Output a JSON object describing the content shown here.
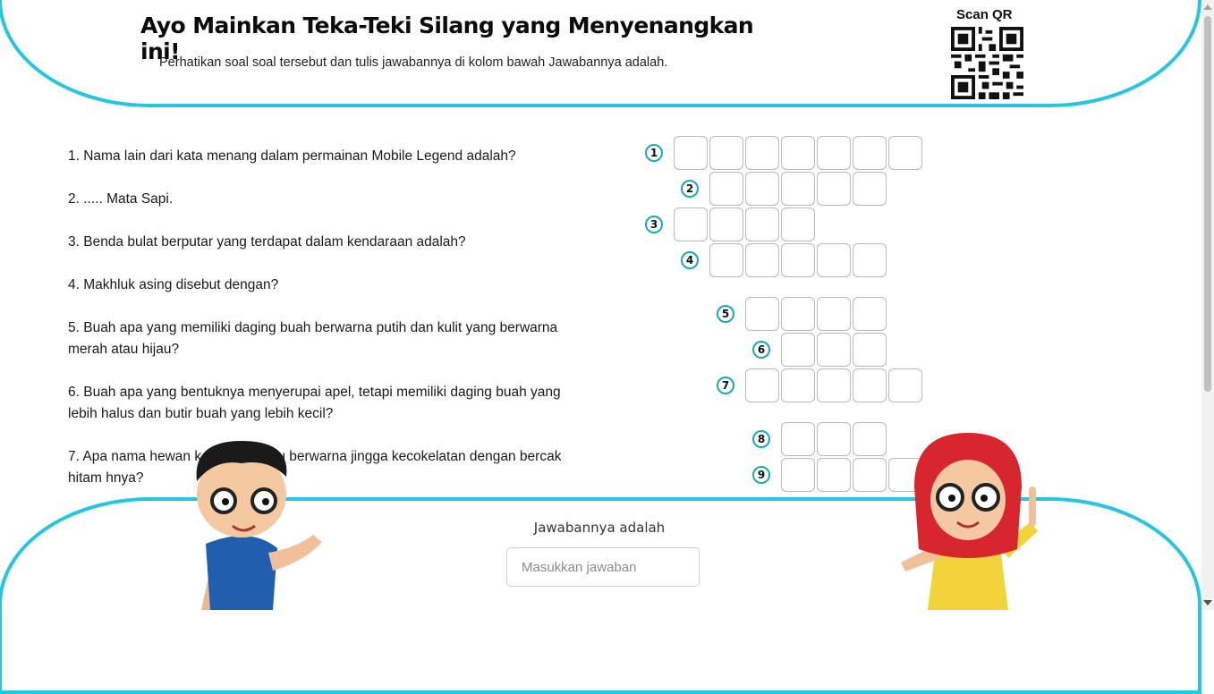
{
  "header": {
    "title": "Ayo Mainkan Teka-Teki Silang yang Menyenangkan ini!",
    "subtitle": "Perhatikan soal soal tersebut dan tulis jawabannya di kolom bawah Jawabannya adalah.",
    "qr_label": "Scan QR"
  },
  "questions": [
    "1. Nama lain dari kata menang dalam permainan Mobile Legend adalah?",
    "2. ..... Mata Sapi.",
    "3. Benda bulat berputar yang terdapat dalam kendaraan adalah?",
    "4. Makhluk asing disebut dengan?",
    "5. Buah apa yang memiliki daging buah berwarna putih dan kulit yang berwarna merah atau hijau?",
    "6. Buah apa yang bentuknya menyerupai apel, tetapi memiliki daging buah yang lebih halus dan butir buah yang lebih kecil?",
    "7. Apa nama hewan k                memiliki bulu berwarna jingga kecokelatan dengan bercak hitam                       hnya?"
  ],
  "crossword": {
    "numbers": [
      "1",
      "2",
      "3",
      "4",
      "5",
      "6",
      "7",
      "8",
      "9"
    ],
    "row_lengths": [
      7,
      5,
      4,
      5,
      4,
      3,
      5,
      3,
      4
    ]
  },
  "footer": {
    "answer_label": "Jawabannya adalah",
    "answer_placeholder": "Masukkan jawaban"
  },
  "colors": {
    "accent": "#26c6e0",
    "number_ring": "#18a8c4"
  }
}
